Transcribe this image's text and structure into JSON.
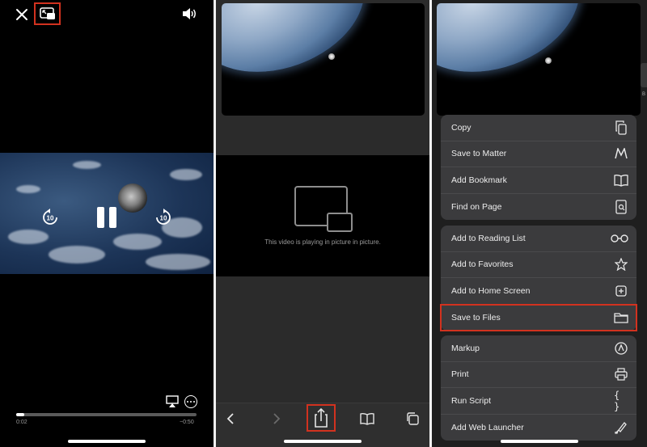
{
  "panel1": {
    "time_elapsed": "0:02",
    "time_remaining": "−0:50",
    "progress": 0.045,
    "skip_back_label": "10",
    "skip_forward_label": "10"
  },
  "panel2": {
    "pip_message": "This video is playing in picture in picture."
  },
  "panel3": {
    "side_letter": "B",
    "group1": [
      {
        "label": "Copy",
        "icon": "copy-icon"
      },
      {
        "label": "Save to Matter",
        "icon": "matter-icon"
      },
      {
        "label": "Add Bookmark",
        "icon": "book-icon"
      },
      {
        "label": "Find on Page",
        "icon": "find-page-icon"
      }
    ],
    "group2": [
      {
        "label": "Add to Reading List",
        "icon": "glasses-icon"
      },
      {
        "label": "Add to Favorites",
        "icon": "star-icon"
      },
      {
        "label": "Add to Home Screen",
        "icon": "plus-square-icon"
      },
      {
        "label": "Save to Files",
        "icon": "folder-icon"
      }
    ],
    "group3": [
      {
        "label": "Markup",
        "icon": "markup-icon"
      },
      {
        "label": "Print",
        "icon": "printer-icon"
      },
      {
        "label": "Run Script",
        "icon": "braces-icon"
      },
      {
        "label": "Add Web Launcher",
        "icon": "launcher-icon"
      }
    ]
  },
  "colors": {
    "highlight": "#d2321f",
    "sheet_row": "#3b3b3d"
  }
}
